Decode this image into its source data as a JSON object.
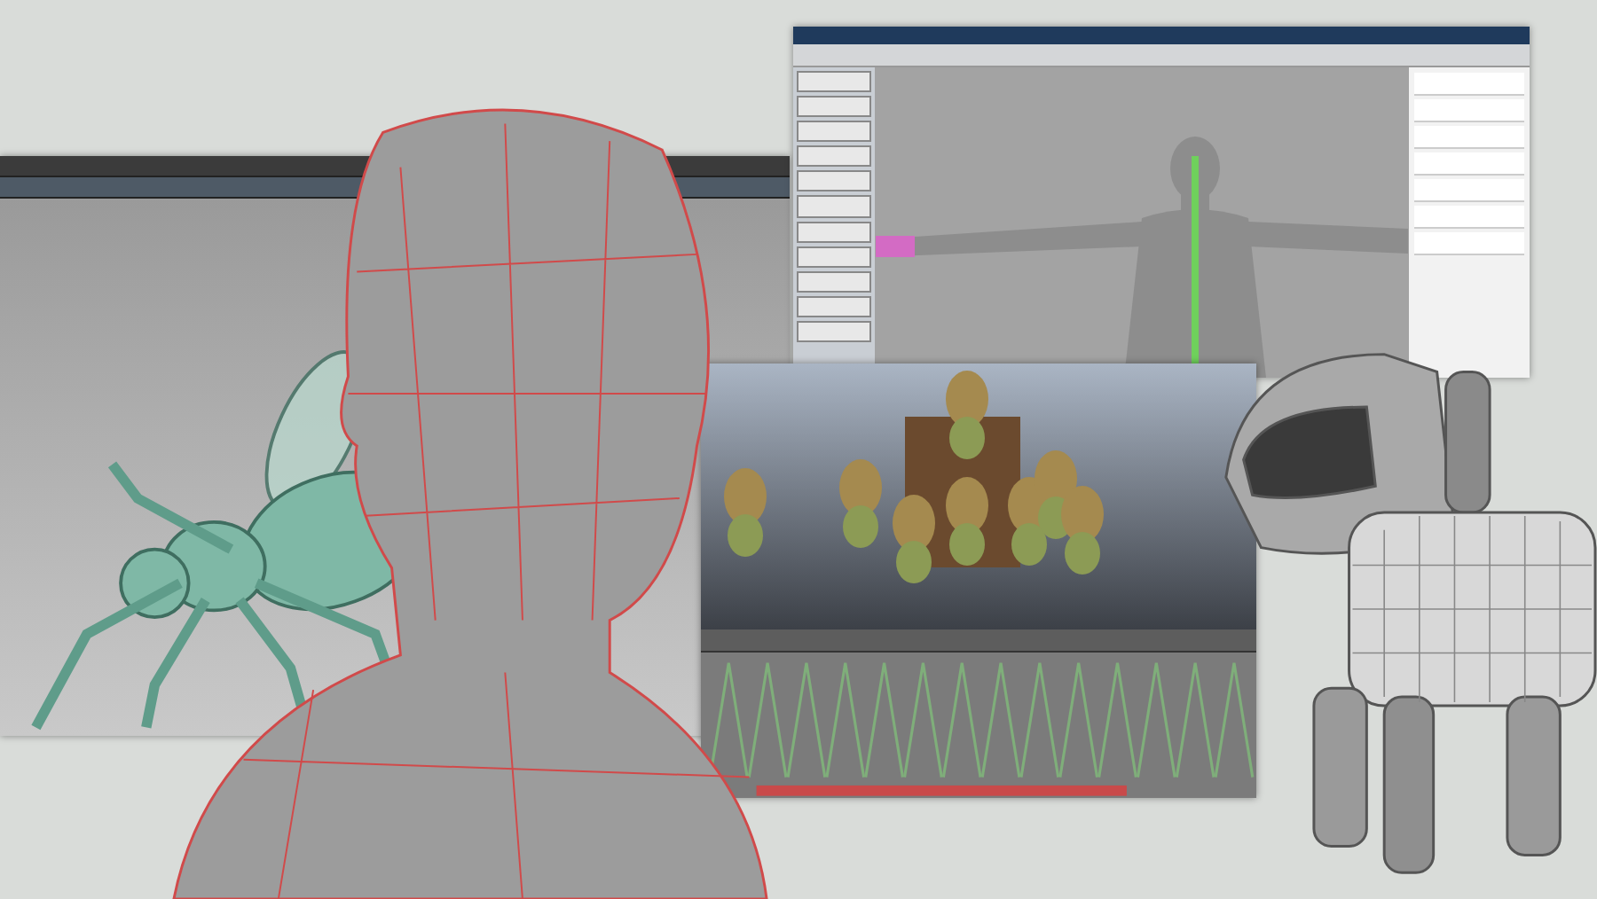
{
  "collage": {
    "items": [
      {
        "kind": "modeling-window"
      },
      {
        "kind": "rigging-window"
      },
      {
        "kind": "render-window"
      },
      {
        "kind": "robot-dog"
      },
      {
        "kind": "head-model"
      }
    ]
  }
}
